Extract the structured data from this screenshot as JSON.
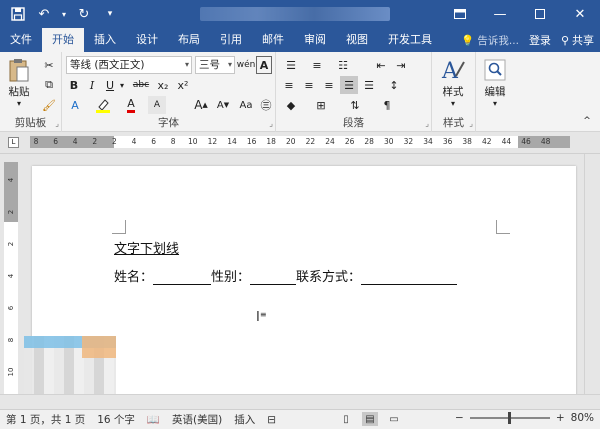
{
  "titlebar": {
    "qat": {
      "save_icon": "save-icon",
      "undo_icon": "undo-icon",
      "redo_icon": "redo-icon",
      "customize_icon": "chevron-down-icon"
    },
    "controls": {
      "ribbon_options": "ribbon-display-icon",
      "minimize": "minimize-icon",
      "maximize": "maximize-icon",
      "close": "close-icon"
    }
  },
  "tabs": [
    {
      "label": "文件"
    },
    {
      "label": "开始",
      "active": true
    },
    {
      "label": "插入"
    },
    {
      "label": "设计"
    },
    {
      "label": "布局"
    },
    {
      "label": "引用"
    },
    {
      "label": "邮件"
    },
    {
      "label": "审阅"
    },
    {
      "label": "视图"
    },
    {
      "label": "开发工具"
    }
  ],
  "tabright": {
    "tellme": "告诉我...",
    "login": "登录",
    "share": "共享"
  },
  "ribbon": {
    "clipboard": {
      "paste": "粘贴",
      "label": "剪贴板"
    },
    "font": {
      "font_name": "等线 (西文正文)",
      "font_size": "三号",
      "wen": "wén",
      "bold": "B",
      "italic": "I",
      "underline": "U",
      "strike": "abc",
      "sub": "x₂",
      "sup": "x²",
      "font_color": "A",
      "grow": "A",
      "shrink": "A",
      "aa": "Aa",
      "label": "字体"
    },
    "paragraph": {
      "label": "段落"
    },
    "styles": {
      "button": "样式",
      "label": "样式"
    },
    "editing": {
      "button": "编辑"
    }
  },
  "ruler": {
    "numbers": [
      "8",
      "6",
      "4",
      "2",
      "2",
      "4",
      "6",
      "8",
      "10",
      "12",
      "14",
      "16",
      "18",
      "20",
      "22",
      "24",
      "26",
      "28",
      "30",
      "32",
      "34",
      "36",
      "38",
      "42",
      "44",
      "46",
      "48"
    ]
  },
  "vruler": {
    "numbers": [
      "4",
      "2",
      "2",
      "4",
      "6",
      "8",
      "10"
    ]
  },
  "document": {
    "line1": "文字下划线",
    "name_label": "姓名：",
    "gender_label": "性别：",
    "contact_label": "联系方式："
  },
  "status": {
    "page": "第 1 页，共 1 页",
    "words": "16 个字",
    "lang": "英语(美国)",
    "mode": "插入",
    "zoom": "80%",
    "zoom_minus": "−",
    "zoom_plus": "+"
  },
  "colors": {
    "brand": "#2b579a",
    "ribbon_bg": "#f3f3f3",
    "canvas_bg": "#e6e6e6"
  }
}
